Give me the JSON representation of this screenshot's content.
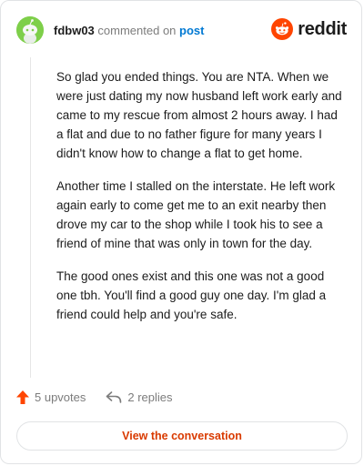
{
  "header": {
    "username": "fdbw03",
    "commented_on": "commented on",
    "post_link": "post",
    "brand": "reddit"
  },
  "comment": {
    "paragraphs": [
      "So glad you ended things. You are NTA. When we were just dating my now husband left work early and came to my rescue from almost 2 hours away. I had a flat and due to no father figure for many years I didn't know how to change a flat to get home.",
      "Another time I stalled on the interstate. He left work again early to come get me to an exit nearby then drove my car to the shop while I took his to see a friend of mine that was only in town for the day.",
      "The good ones exist and this one was not a good one tbh. You'll find a good guy one day. I'm glad a friend could help and you're safe."
    ]
  },
  "actions": {
    "upvotes": "5 upvotes",
    "replies": "2 replies"
  },
  "cta": {
    "label": "View the conversation"
  },
  "colors": {
    "brand_orange": "#ff4500",
    "link_blue": "#0079d3",
    "cta_text": "#d93a00",
    "avatar_green": "#7ecf4a"
  },
  "icons": {
    "avatar": "snoo-avatar-icon",
    "logo": "reddit-snoo-icon",
    "upvote": "upvote-arrow-icon",
    "reply": "reply-arrow-icon"
  }
}
